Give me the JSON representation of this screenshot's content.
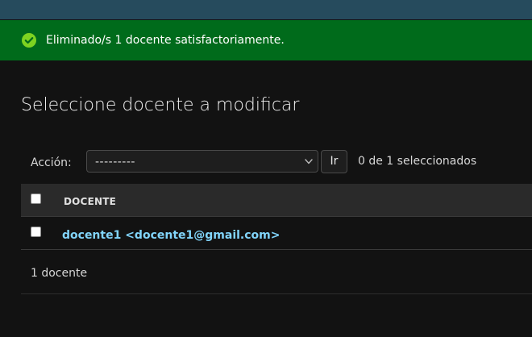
{
  "message": {
    "text": "Eliminado/s 1 docente satisfactoriamente.",
    "icon": "success-check-icon",
    "background": "#006b1b"
  },
  "page": {
    "title": "Seleccione docente a modificar"
  },
  "actions": {
    "label": "Acción:",
    "select_value": "---------",
    "go_label": "Ir",
    "selection_count": "0 de 1 seleccionados"
  },
  "table": {
    "columns": [
      "DOCENTE"
    ],
    "rows": [
      {
        "docente": "docente1 <docente1@gmail.com>"
      }
    ]
  },
  "paginator": {
    "text": "1 docente"
  },
  "colors": {
    "header_bar": "#264b5d",
    "link": "#81d4fa",
    "background": "#121212"
  }
}
